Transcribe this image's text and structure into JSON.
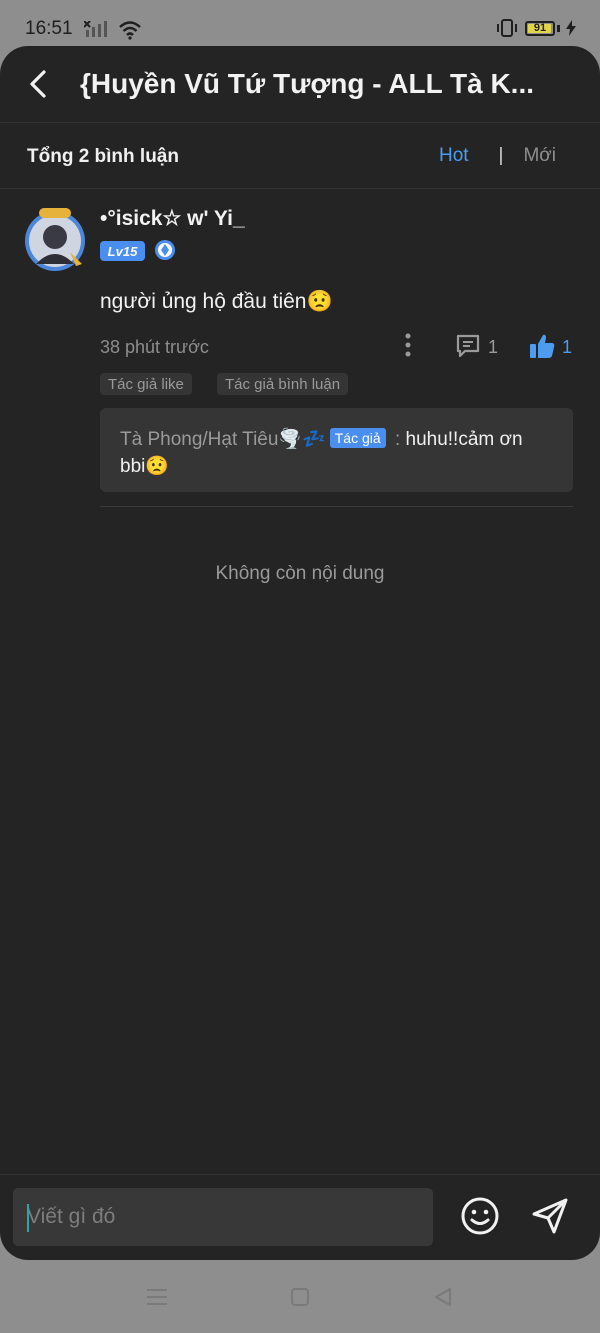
{
  "status_bar": {
    "time": "16:51",
    "battery": "91",
    "battery_level": 0.91,
    "icons": [
      "sim-off-icon",
      "signal-icon",
      "wifi-icon",
      "vibrate-icon",
      "battery-icon",
      "charging-icon"
    ]
  },
  "header": {
    "title": "{Huyền Vũ Tứ Tượng - ALL Tà K..."
  },
  "comments_summary": {
    "total": "Tổng 2 bình luận",
    "sort_hot": "Hot",
    "separator": "|",
    "sort_new": "Mới"
  },
  "comment": {
    "username": "•°isick☆ w' Yi_",
    "level": "Lv15",
    "text": "người ủng hộ đầu tiên😟",
    "time": "38 phút trước",
    "reply_count": "1",
    "like_count": "1",
    "tags": [
      "Tác giả like",
      "Tác giả bình luận"
    ],
    "reply": {
      "author": "Tà Phong/Hạt Tiêu🌪️💤",
      "author_badge": "Tác giả",
      "separator": " : ",
      "text": "huhu!!cảm ơn bbi😟"
    }
  },
  "footer_text": "Không còn nội dung",
  "input": {
    "placeholder": "Viết gì đó"
  },
  "colors": {
    "accent": "#4d9cf0",
    "background": "#242424",
    "badge": "#4a8ff0"
  }
}
